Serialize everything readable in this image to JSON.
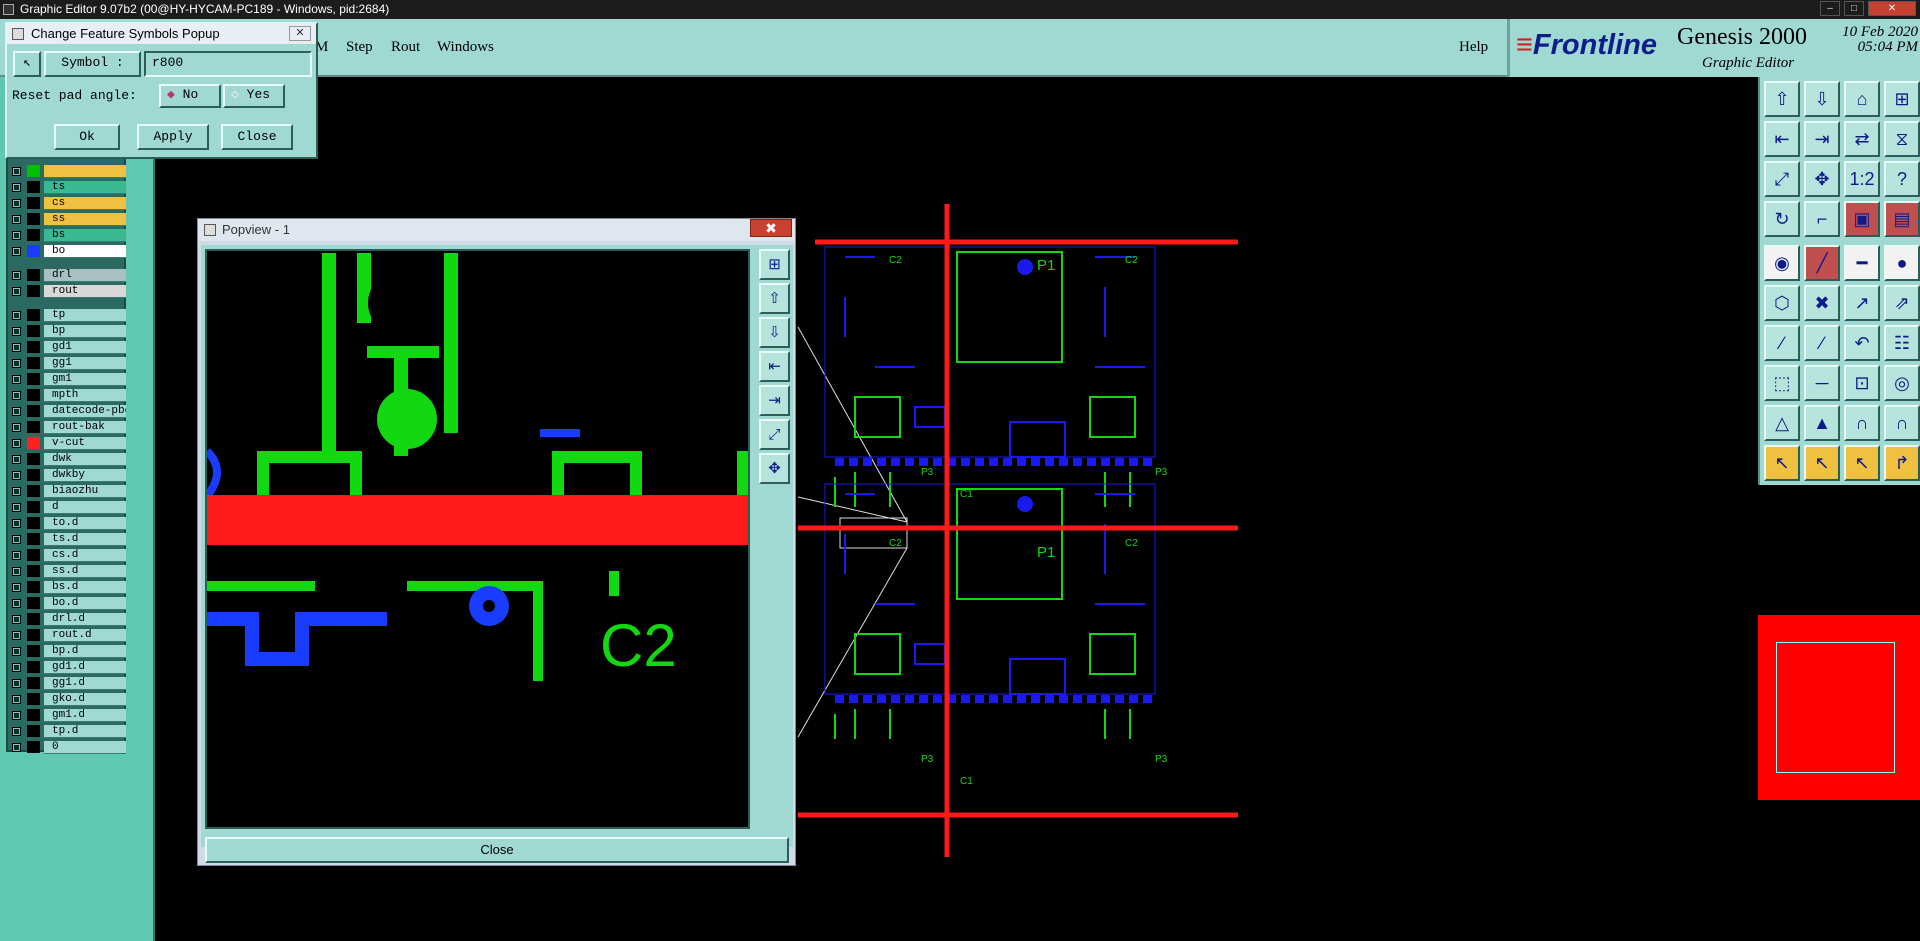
{
  "window": {
    "title": "Graphic Editor 9.07b2 (00@HY-HYCAM-PC189 - Windows, pid:2684)",
    "min": "–",
    "max": "□",
    "close": "✕"
  },
  "menu": {
    "items": [
      "M",
      "Step",
      "Rout",
      "Windows"
    ],
    "help": "Help"
  },
  "brand": {
    "logo": "Frontline",
    "product": "Genesis 2000",
    "subtitle": "Graphic Editor",
    "date": "10 Feb 2020",
    "time": "05:04 PM"
  },
  "symbol_popup": {
    "title": "Change Feature Symbols Popup",
    "symbol_label": "Symbol :",
    "symbol_value": "r800",
    "reset_label": "Reset pad angle:",
    "opt_no": "No",
    "opt_yes": "Yes",
    "ok": "Ok",
    "apply": "Apply",
    "close": "Close"
  },
  "layers": [
    {
      "name": "",
      "color": "#f0c040",
      "swatch": "#00c000",
      "gap": false
    },
    {
      "name": "ts",
      "color": "#3ab892",
      "swatch": "#000000",
      "gap": false
    },
    {
      "name": "cs",
      "color": "#f0c040",
      "swatch": "#000000",
      "gap": false
    },
    {
      "name": "ss",
      "color": "#f0c040",
      "swatch": "#000000",
      "gap": false
    },
    {
      "name": "bs",
      "color": "#3ab892",
      "swatch": "#000000",
      "gap": false
    },
    {
      "name": "bo",
      "color": "#ffffff",
      "swatch": "#1a3cff",
      "gap": false
    },
    {
      "name": "drl",
      "color": "#a8c0c0",
      "swatch": "#000000",
      "gap": true
    },
    {
      "name": "rout",
      "color": "#d8d8d8",
      "swatch": "#000000",
      "gap": false
    },
    {
      "name": "tp",
      "color": "#9fd9d2",
      "swatch": "#000000",
      "gap": true
    },
    {
      "name": "bp",
      "color": "#9fd9d2",
      "swatch": "#000000",
      "gap": false
    },
    {
      "name": "gd1",
      "color": "#9fd9d2",
      "swatch": "#000000",
      "gap": false
    },
    {
      "name": "gg1",
      "color": "#9fd9d2",
      "swatch": "#000000",
      "gap": false
    },
    {
      "name": "gm1",
      "color": "#9fd9d2",
      "swatch": "#000000",
      "gap": false
    },
    {
      "name": "mpth",
      "color": "#9fd9d2",
      "swatch": "#000000",
      "gap": false
    },
    {
      "name": "datecode-pbc",
      "color": "#9fd9d2",
      "swatch": "#000000",
      "gap": false
    },
    {
      "name": "rout-bak",
      "color": "#9fd9d2",
      "swatch": "#000000",
      "gap": false
    },
    {
      "name": "v-cut",
      "color": "#9fd9d2",
      "swatch": "#ff2020",
      "gap": false
    },
    {
      "name": "dwk",
      "color": "#9fd9d2",
      "swatch": "#000000",
      "gap": false
    },
    {
      "name": "dwkby",
      "color": "#9fd9d2",
      "swatch": "#000000",
      "gap": false
    },
    {
      "name": "biaozhu",
      "color": "#9fd9d2",
      "swatch": "#000000",
      "gap": false
    },
    {
      "name": "d",
      "color": "#9fd9d2",
      "swatch": "#000000",
      "gap": false
    },
    {
      "name": "to.d",
      "color": "#9fd9d2",
      "swatch": "#000000",
      "gap": false
    },
    {
      "name": "ts.d",
      "color": "#9fd9d2",
      "swatch": "#000000",
      "gap": false
    },
    {
      "name": "cs.d",
      "color": "#9fd9d2",
      "swatch": "#000000",
      "gap": false
    },
    {
      "name": "ss.d",
      "color": "#9fd9d2",
      "swatch": "#000000",
      "gap": false
    },
    {
      "name": "bs.d",
      "color": "#9fd9d2",
      "swatch": "#000000",
      "gap": false
    },
    {
      "name": "bo.d",
      "color": "#9fd9d2",
      "swatch": "#000000",
      "gap": false
    },
    {
      "name": "drl.d",
      "color": "#9fd9d2",
      "swatch": "#000000",
      "gap": false
    },
    {
      "name": "rout.d",
      "color": "#9fd9d2",
      "swatch": "#000000",
      "gap": false
    },
    {
      "name": "bp.d",
      "color": "#9fd9d2",
      "swatch": "#000000",
      "gap": false
    },
    {
      "name": "gd1.d",
      "color": "#9fd9d2",
      "swatch": "#000000",
      "gap": false
    },
    {
      "name": "gg1.d",
      "color": "#9fd9d2",
      "swatch": "#000000",
      "gap": false
    },
    {
      "name": "gko.d",
      "color": "#9fd9d2",
      "swatch": "#000000",
      "gap": false
    },
    {
      "name": "gm1.d",
      "color": "#9fd9d2",
      "swatch": "#000000",
      "gap": false
    },
    {
      "name": "tp.d",
      "color": "#9fd9d2",
      "swatch": "#000000",
      "gap": false
    },
    {
      "name": "0",
      "color": "#9fd9d2",
      "swatch": "#000000",
      "gap": false
    }
  ],
  "popview": {
    "title": "Popview - 1",
    "close_x": "✖",
    "close": "Close",
    "canvas_text": "C2"
  },
  "board": {
    "labels": [
      "P1",
      "P1",
      "C2",
      "C2",
      "C2",
      "C2",
      "P3",
      "P3",
      "P3",
      "P3",
      "C1",
      "C1"
    ]
  },
  "toolbox": {
    "rows": [
      [
        {
          "icon": "layer-up-icon",
          "glyph": "⇧"
        },
        {
          "icon": "layer-down-icon",
          "glyph": "⇩"
        },
        {
          "icon": "home-icon",
          "glyph": "⌂"
        },
        {
          "icon": "window-split-icon",
          "glyph": "⊞"
        }
      ],
      [
        {
          "icon": "pan-left-icon",
          "glyph": "⇤"
        },
        {
          "icon": "pan-right-icon",
          "glyph": "⇥"
        },
        {
          "icon": "swap-icon",
          "glyph": "⇄"
        },
        {
          "icon": "step-icon",
          "glyph": "⧖"
        }
      ],
      [
        {
          "icon": "zoom-fit-icon",
          "glyph": "⤢"
        },
        {
          "icon": "zoom-center-icon",
          "glyph": "✥"
        },
        {
          "icon": "scale-icon",
          "glyph": "1:2"
        },
        {
          "icon": "help-icon",
          "glyph": "?"
        }
      ],
      [
        {
          "icon": "rotate-icon",
          "glyph": "↻"
        },
        {
          "icon": "measure-icon",
          "glyph": "⌐"
        },
        {
          "icon": "net-icon",
          "glyph": "▣",
          "style": "red"
        },
        {
          "icon": "netlist-icon",
          "glyph": "▤",
          "style": "red"
        }
      ],
      [
        {
          "icon": "snap-icon",
          "glyph": "◉",
          "style": "wht"
        },
        {
          "icon": "edit-line-icon",
          "glyph": "╱",
          "style": "red"
        },
        {
          "icon": "ruler-icon",
          "glyph": "━",
          "style": "wht"
        },
        {
          "icon": "pad-icon",
          "glyph": "●",
          "style": "wht"
        }
      ],
      [
        {
          "icon": "connect-icon",
          "glyph": "⬡"
        },
        {
          "icon": "cross-icon",
          "glyph": "✖"
        },
        {
          "icon": "move-node-icon",
          "glyph": "↗"
        },
        {
          "icon": "route-icon",
          "glyph": "⇗"
        }
      ],
      [
        {
          "icon": "draw-line-icon",
          "glyph": "∕"
        },
        {
          "icon": "slope-icon",
          "glyph": "∕"
        },
        {
          "icon": "arc-icon",
          "glyph": "↶"
        },
        {
          "icon": "fillet-icon",
          "glyph": "☷"
        }
      ],
      [
        {
          "icon": "pad-line-icon",
          "glyph": "⬚"
        },
        {
          "icon": "trace-icon",
          "glyph": "─"
        },
        {
          "icon": "bracket-icon",
          "glyph": "⊡"
        },
        {
          "icon": "circle-icon",
          "glyph": "◎"
        }
      ],
      [
        {
          "icon": "triangle-icon",
          "glyph": "△"
        },
        {
          "icon": "triangle-edit-icon",
          "glyph": "▲"
        },
        {
          "icon": "arch-icon",
          "glyph": "∩"
        },
        {
          "icon": "arch-edit-icon",
          "glyph": "∩"
        }
      ],
      [
        {
          "icon": "select-icon",
          "glyph": "↖",
          "style": "yel"
        },
        {
          "icon": "select-area-icon",
          "glyph": "↖",
          "style": "yel"
        },
        {
          "icon": "select-net-icon",
          "glyph": "↖",
          "style": "yel"
        },
        {
          "icon": "select-path-icon",
          "glyph": "↱",
          "style": "yel"
        }
      ]
    ]
  }
}
